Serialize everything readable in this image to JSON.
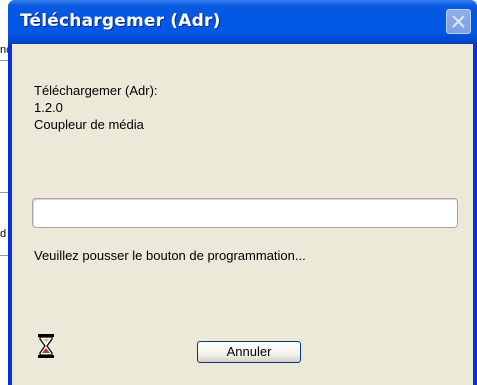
{
  "background_window": {
    "fragment_top": "nc",
    "fragment_mid": "d"
  },
  "dialog": {
    "title": "Téléchargemer (Adr)",
    "close_icon": "close-icon",
    "info_lines": {
      "name": "Téléchargemer (Adr):",
      "version": "1.2.0",
      "description": "Coupleur de média"
    },
    "progress_value": 0,
    "status_text": "Veuillez pousser le bouton de programmation...",
    "hourglass_icon": "hourglass-icon",
    "cancel_label": "Annuler"
  },
  "colors": {
    "titlebar_blue": "#0256e5",
    "frame_blue": "#0831d9",
    "dialog_face": "#ece9d8",
    "button_border": "#003c74"
  }
}
